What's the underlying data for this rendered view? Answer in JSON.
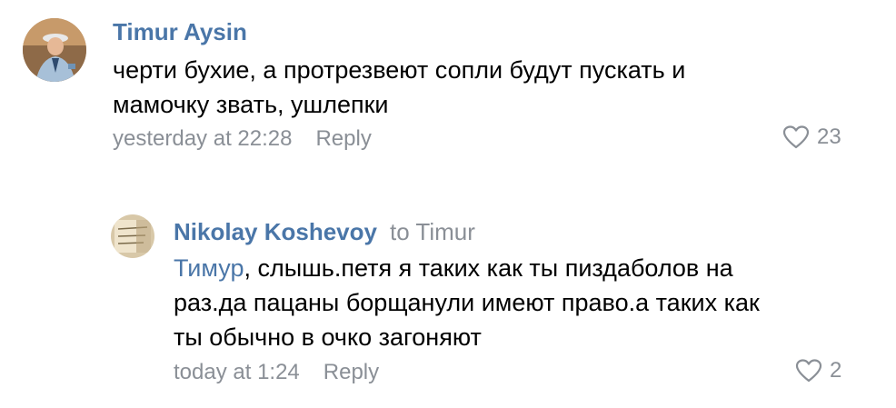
{
  "comments": [
    {
      "author": "Timur Aysin",
      "text_lines": [
        "черти бухие, а протрезвеют сопли будут пускать и",
        "мамочку звать, ушлепки"
      ],
      "time": "yesterday at 22:28",
      "reply_label": "Reply",
      "likes": "23"
    },
    {
      "author": "Nikolay Koshevoy",
      "reply_to": "to Timur",
      "mention": "Тимур",
      "text_line1_rest": ", слышь.петя я таких как ты пиздаболов на",
      "text_lines_rest": [
        "раз.да пацаны борщанули имеют право.а таких как",
        "ты обычно в очко загоняют"
      ],
      "time": "today at 1:24",
      "reply_label": "Reply",
      "likes": "2"
    }
  ],
  "colors": {
    "author": "#4a76a8",
    "meta": "#8a8f96",
    "text": "#000000"
  },
  "icons": [
    "heart-icon"
  ]
}
